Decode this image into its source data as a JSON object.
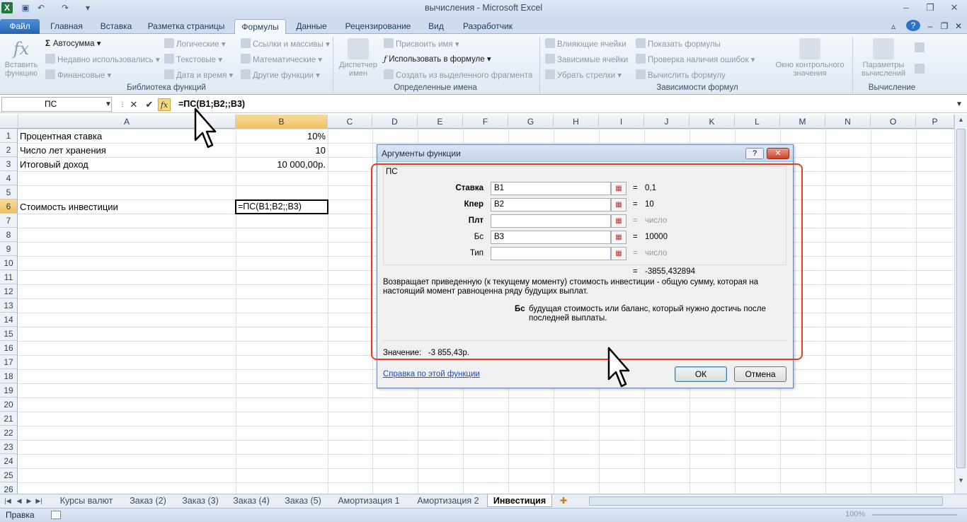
{
  "window": {
    "title": "вычисления  -  Microsoft Excel"
  },
  "tabs": [
    {
      "label": "Файл"
    },
    {
      "label": "Главная"
    },
    {
      "label": "Вставка"
    },
    {
      "label": "Разметка страницы"
    },
    {
      "label": "Формулы"
    },
    {
      "label": "Данные"
    },
    {
      "label": "Рецензирование"
    },
    {
      "label": "Вид"
    },
    {
      "label": "Разработчик"
    }
  ],
  "ribbon": {
    "insert_function": "Вставить функцию",
    "lib": {
      "autosum": "Автосумма",
      "recent": "Недавно использовались",
      "financial": "Финансовые",
      "logical": "Логические",
      "text": "Текстовые",
      "datetime": "Дата и время",
      "lookup": "Ссылки и массивы",
      "math": "Математические",
      "other": "Другие функции",
      "group": "Библиотека функций"
    },
    "names": {
      "manager": "Диспетчер имен",
      "assign": "Присвоить имя",
      "use": "Использовать в формуле",
      "create": "Создать из выделенного фрагмента",
      "group": "Определенные имена"
    },
    "audit": {
      "precedents": "Влияющие ячейки",
      "dependents": "Зависимые ячейки",
      "remove": "Убрать стрелки",
      "show": "Показать формулы",
      "check": "Проверка наличия ошибок",
      "evaluate": "Вычислить формулу",
      "watch": "Окно контрольного значения",
      "group": "Зависимости формул"
    },
    "calc": {
      "options": "Параметры вычислений",
      "group": "Вычисление"
    }
  },
  "formula_bar": {
    "name_box": "ПС",
    "formula": "=ПС(B1;B2;;B3)"
  },
  "columns": [
    "A",
    "B",
    "C",
    "D",
    "E",
    "F",
    "G",
    "H",
    "I",
    "J",
    "K",
    "L",
    "M",
    "N",
    "O",
    "P"
  ],
  "rows": [
    "1",
    "2",
    "3",
    "4",
    "5",
    "6",
    "7",
    "8",
    "9",
    "10",
    "11",
    "12",
    "13",
    "14",
    "15",
    "16",
    "17",
    "18",
    "19",
    "20",
    "21",
    "22",
    "23",
    "24",
    "25",
    "26"
  ],
  "cells": {
    "a1": "Процентная ставка",
    "b1": "10%",
    "a2": "Число лет хранения",
    "b2": "10",
    "a3": "Итоговый доход",
    "b3": "10 000,00р.",
    "a6": "Стоимость инвестиции",
    "b6": "=ПС(B1;B2;;B3)"
  },
  "dialog": {
    "title": "Аргументы функции",
    "help_btn": "?",
    "close_btn": "✕",
    "function_name": "ПС",
    "args": [
      {
        "label": "Ставка",
        "value": "B1",
        "result": "0,1"
      },
      {
        "label": "Кпер",
        "value": "B2",
        "result": "10"
      },
      {
        "label": "Плт",
        "value": "",
        "result": "число"
      },
      {
        "label": "Бс",
        "value": "B3",
        "result": "10000"
      },
      {
        "label": "Тип",
        "value": "",
        "result": "число"
      }
    ],
    "eq": "=",
    "total": "-3855,432894",
    "description": "Возвращает приведенную (к текущему моменту) стоимость инвестиции - общую сумму, которая на настоящий момент равноценна ряду будущих выплат.",
    "arg_desc_name": "Бс",
    "arg_desc": "будущая стоимость или баланс, который нужно достичь после последней выплаты.",
    "value_label": "Значение:",
    "value": "-3 855,43р.",
    "help_link": "Справка по этой функции",
    "ok": "ОК",
    "cancel": "Отмена"
  },
  "sheets": [
    "Курсы валют",
    "Заказ (2)",
    "Заказ (3)",
    "Заказ (4)",
    "Заказ (5)",
    "Амортизация 1",
    "Амортизация 2",
    "Инвестиция"
  ],
  "status": {
    "mode": "Правка",
    "zoom": "100%"
  }
}
